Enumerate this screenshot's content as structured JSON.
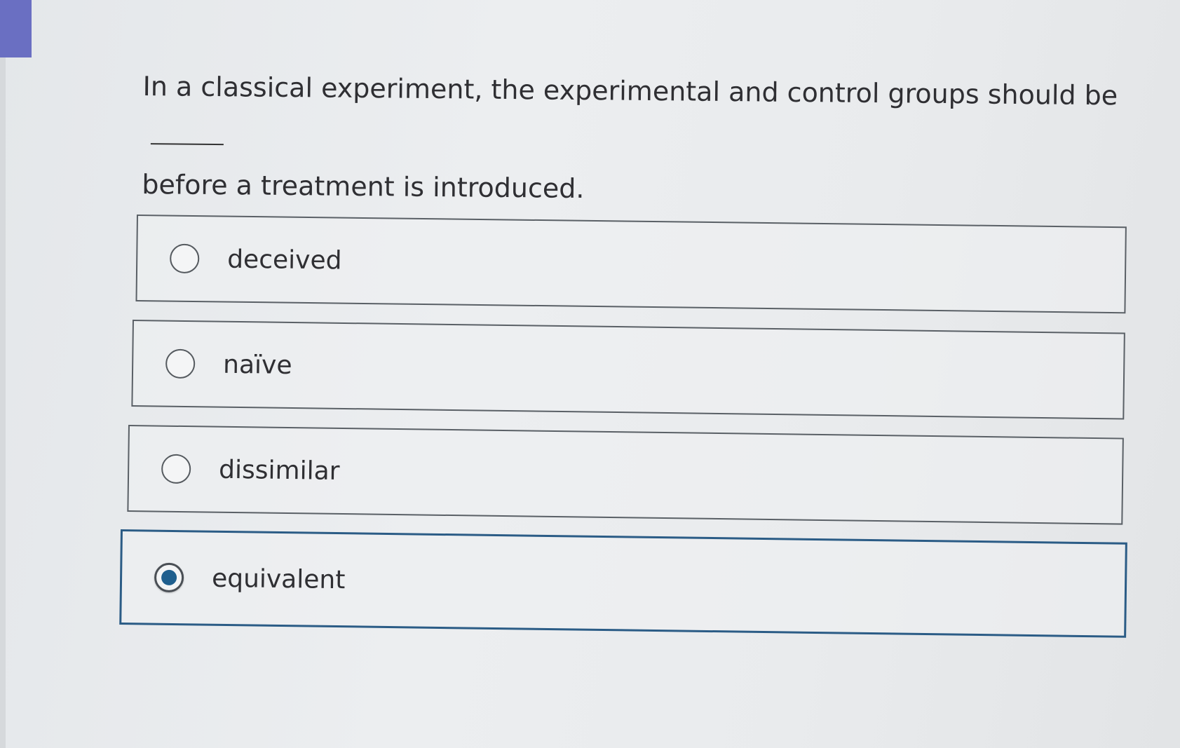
{
  "question": {
    "text_before_blank": "In a classical experiment, the experimental and control groups should be",
    "text_after_blank": "before a treatment is introduced."
  },
  "options": [
    {
      "label": "deceived",
      "selected": false
    },
    {
      "label": "naïve",
      "selected": false
    },
    {
      "label": "dissimilar",
      "selected": false
    },
    {
      "label": "equivalent",
      "selected": true
    }
  ],
  "colors": {
    "accent": "#6a6fc2",
    "selected_radio": "#1f5f8e",
    "selected_border": "#2b5c86"
  }
}
